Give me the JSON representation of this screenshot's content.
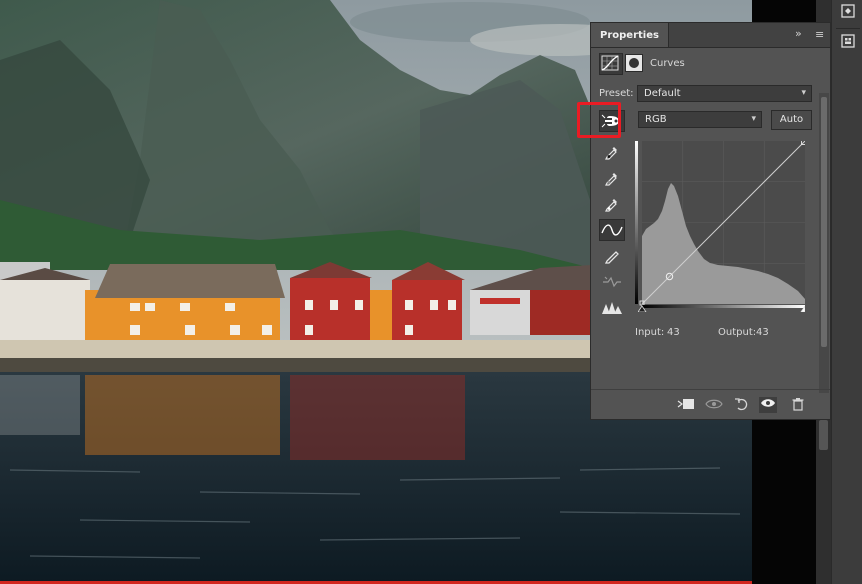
{
  "canvas": {
    "description_name": "lofoten-harbor-photo"
  },
  "panel": {
    "tab_label": "Properties",
    "collapse_glyph": "»",
    "menu_glyph": "≡",
    "adjustment_label": "Curves",
    "preset_label": "Preset:",
    "preset_value": "Default",
    "channel_value": "RGB",
    "auto_label": "Auto",
    "input_label": "Input:",
    "input_value": "43",
    "output_label": "Output:",
    "output_value": "43"
  },
  "tools": [
    {
      "name": "targeted-adjustment-icon",
      "active": true
    },
    {
      "name": "black-point-eyedropper-icon"
    },
    {
      "name": "gray-point-eyedropper-icon"
    },
    {
      "name": "white-point-eyedropper-icon"
    },
    {
      "name": "curve-points-icon",
      "active": true
    },
    {
      "name": "pencil-draw-icon"
    },
    {
      "name": "smooth-curve-icon"
    },
    {
      "name": "clipping-warning-icon"
    }
  ],
  "footer_icons": [
    "clip-to-layer-icon",
    "view-previous-state-icon",
    "reset-icon",
    "visibility-eye-icon",
    "trash-icon"
  ],
  "curve": {
    "control_point": {
      "input": 43,
      "output": 43
    },
    "range": [
      0,
      255
    ]
  },
  "colors": {
    "highlight": "#ea1c24",
    "panel_bg": "#535353",
    "graph_bg": "#4b4b4b",
    "histogram": "#9a9a9a"
  }
}
